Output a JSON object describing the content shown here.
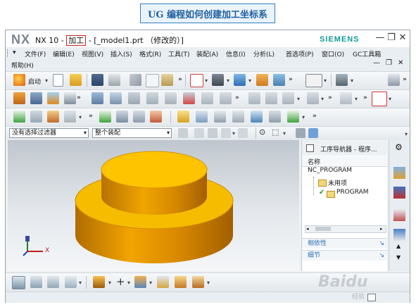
{
  "banner": {
    "title": "UG 编程如何创建加工坐标系"
  },
  "titlebar": {
    "logo": "NX",
    "version": "NX 10",
    "sep1": "-",
    "app": "加工",
    "sep2": "-",
    "file": "[_model1.prt （修改的）]",
    "brand": "SIEMENS",
    "minimize": "—",
    "restore": "❐",
    "close": "✕"
  },
  "menubar": {
    "items": [
      "文件(F)",
      "编辑(E)",
      "视图(V)",
      "插入(S)",
      "格式(R)",
      "工具(T)",
      "装配(A)",
      "信息(I)",
      "分析(L)",
      "首选项(P)",
      "窗口(O)",
      "GC工具箱"
    ],
    "help": "帮助(H)",
    "controls": [
      "—",
      "❐",
      "✕"
    ]
  },
  "toolbar1": {
    "start_label": "启动"
  },
  "filterbar": {
    "selection_filter": "没有选择过滤器",
    "assembly_scope": "整个装配"
  },
  "navigator": {
    "title": "工序导航器 - 程序...",
    "column_header": "名称",
    "root": "NC_PROGRAM",
    "unused": "未用项",
    "program": "PROGRAM",
    "sections": [
      "相依性",
      "细节"
    ]
  },
  "viewport": {
    "axis_x_label": "X",
    "part_color": "#F2B500",
    "background_top": "#BFC6CD",
    "background_bottom": "#F4F6F8"
  },
  "watermark": {
    "brand": "Baidu",
    "sub": "经验"
  }
}
